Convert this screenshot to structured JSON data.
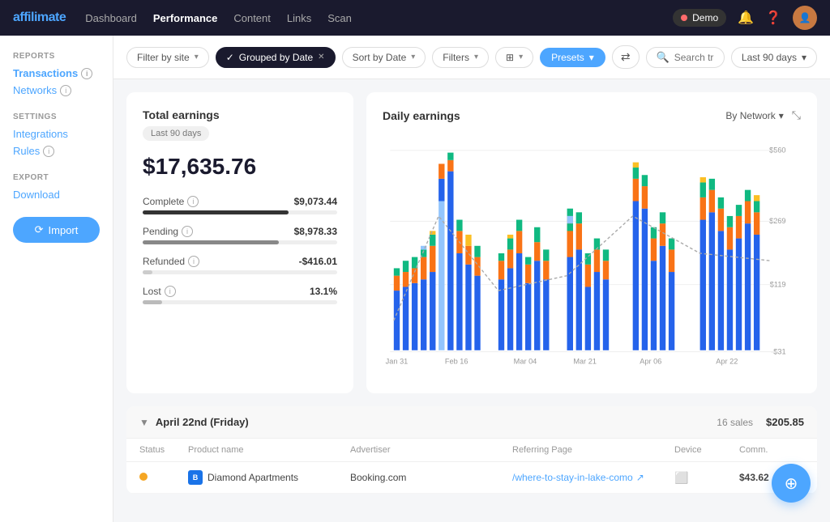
{
  "brand": {
    "name_prefix": "affili",
    "name_suffix": "mate"
  },
  "navbar": {
    "links": [
      {
        "label": "Dashboard",
        "active": false
      },
      {
        "label": "Performance",
        "active": true
      },
      {
        "label": "Content",
        "active": false
      },
      {
        "label": "Links",
        "active": false
      },
      {
        "label": "Scan",
        "active": false
      }
    ],
    "demo_label": "Demo"
  },
  "sidebar": {
    "reports_title": "REPORTS",
    "transactions_label": "Transactions",
    "networks_label": "Networks",
    "settings_title": "SETTINGS",
    "integrations_label": "Integrations",
    "rules_label": "Rules",
    "export_title": "EXPORT",
    "download_label": "Download",
    "import_label": "Import"
  },
  "toolbar": {
    "filter_by_site": "Filter by site",
    "grouped_by_date": "Grouped by Date",
    "sort_by_date": "Sort by Date",
    "filters": "Filters",
    "presets": "Presets",
    "search_placeholder": "Search transactions",
    "date_range": "Last 90 days"
  },
  "earnings_card": {
    "title": "Total earnings",
    "period": "Last 90 days",
    "total": "$17,635.76",
    "complete_label": "Complete",
    "complete_value": "$9,073.44",
    "pending_label": "Pending",
    "pending_value": "$8,978.33",
    "refunded_label": "Refunded",
    "refunded_value": "-$416.01",
    "lost_label": "Lost",
    "lost_value": "13.1%"
  },
  "chart": {
    "title": "Daily earnings",
    "view_by": "By Network",
    "y_labels": [
      "$560",
      "$269",
      "$119",
      "-$31"
    ],
    "x_labels": [
      "Jan 31",
      "Feb 16",
      "Mar 04",
      "Mar 21",
      "Apr 06",
      "Apr 22"
    ]
  },
  "group": {
    "date": "April 22nd (Friday)",
    "count": "16 sales",
    "amount": "$205.85"
  },
  "table": {
    "headers": [
      "Status",
      "Product name",
      "Advertiser",
      "Referring Page",
      "Device",
      "Comm."
    ],
    "rows": [
      {
        "status": "pending",
        "icon": "B",
        "product": "Diamond Apartments",
        "advertiser": "Booking.com",
        "referring_page": "/where-to-stay-in-lake-como",
        "device": "tablet",
        "commission": "$43.62"
      }
    ]
  },
  "fab": {
    "icon": "⊕"
  }
}
